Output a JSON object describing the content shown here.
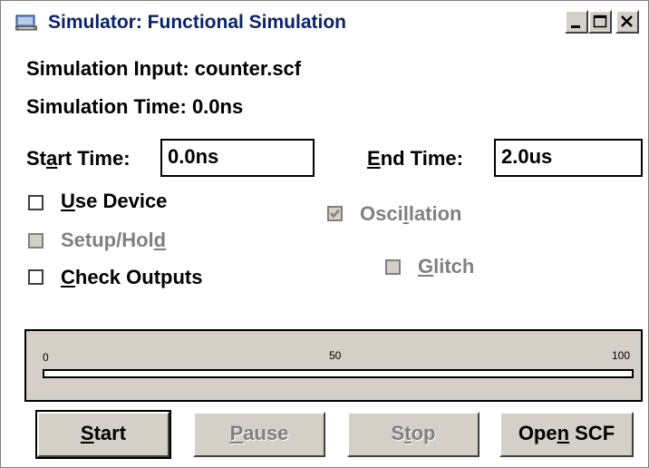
{
  "window": {
    "title": "Simulator: Functional Simulation"
  },
  "info": {
    "simulation_input": "Simulation Input: counter.scf",
    "simulation_time": "Simulation Time: 0.0ns"
  },
  "start_time": {
    "label_prefix": "St",
    "label_mnemonic": "a",
    "label_suffix": "rt Time:",
    "value": "0.0ns"
  },
  "end_time": {
    "label_mnemonic": "E",
    "label_suffix": "nd Time:",
    "value": "2.0us"
  },
  "options": {
    "use_device": {
      "mnemonic": "U",
      "rest": "se Device",
      "checked": false,
      "enabled": true
    },
    "setup_hold": {
      "prefix": "Setup/Hol",
      "mnemonic": "d",
      "checked": false,
      "enabled": false
    },
    "check_outputs": {
      "mnemonic": "C",
      "rest": "heck Outputs",
      "checked": false,
      "enabled": true
    },
    "oscillation": {
      "prefix": "Osci",
      "mnemonic": "l",
      "rest": "lation",
      "checked": true,
      "enabled": false
    },
    "glitch": {
      "mnemonic": "G",
      "rest": "litch",
      "checked": false,
      "enabled": false
    }
  },
  "progress": {
    "tick_0": "0",
    "tick_50": "50",
    "tick_100": "100",
    "value_percent": 0
  },
  "buttons": {
    "start": {
      "mnemonic": "S",
      "rest": "tart"
    },
    "pause": {
      "mnemonic": "P",
      "rest": "ause"
    },
    "stop": {
      "prefix": "S",
      "mnemonic": "t",
      "rest": "op"
    },
    "open_scf": {
      "prefix": "Ope",
      "mnemonic": "n",
      "rest": " SCF"
    }
  }
}
